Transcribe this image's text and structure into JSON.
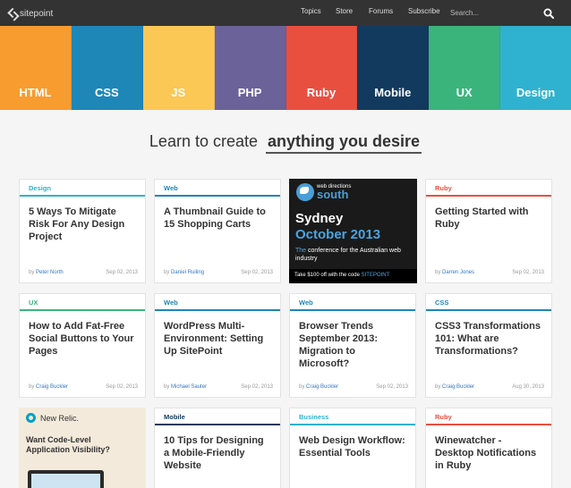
{
  "header": {
    "logo_text": "sitepoint",
    "nav": [
      "Topics",
      "Store",
      "Forums",
      "Subscribe"
    ],
    "search_placeholder": "Search..."
  },
  "categories": [
    {
      "label": "HTML",
      "color": "#f89c2f"
    },
    {
      "label": "CSS",
      "color": "#1f86b8"
    },
    {
      "label": "JS",
      "color": "#fbc755"
    },
    {
      "label": "PHP",
      "color": "#6b6299"
    },
    {
      "label": "Ruby",
      "color": "#e94f3f"
    },
    {
      "label": "Mobile",
      "color": "#123a5f"
    },
    {
      "label": "UX",
      "color": "#3bb47c"
    },
    {
      "label": "Design",
      "color": "#2fb2cf"
    }
  ],
  "headline": {
    "plain": "Learn to create",
    "strong": "anything you desire"
  },
  "colors": {
    "design": "#2fb2cf",
    "web": "#1f86b8",
    "ruby": "#e94f3f",
    "ux": "#3bb47c",
    "css": "#1f86b8",
    "mobile": "#123a5f",
    "business": "#2fb2cf"
  },
  "cards": [
    {
      "tag": "Design",
      "title": "5 Ways To Mitigate Risk For Any Design Project",
      "by": "by",
      "author": "Peter North",
      "date": "Sep 02, 2013"
    },
    {
      "tag": "Web",
      "title": "A Thumbnail Guide to 15 Shopping Carts",
      "by": "by",
      "author": "Daniel Ruiling",
      "date": "Sep 02, 2013"
    },
    {
      "tag": "Ruby",
      "title": "Getting Started with Ruby",
      "by": "by",
      "author": "Darren Jones",
      "date": "Sep 02, 2013"
    },
    {
      "tag": "UX",
      "title": "How to Add Fat-Free Social Buttons to Your Pages",
      "by": "by",
      "author": "Craig Buckler",
      "date": "Sep 02, 2013"
    },
    {
      "tag": "Web",
      "title": "WordPress Multi-Environment: Setting Up SitePoint",
      "by": "by",
      "author": "Michael Sauter",
      "date": "Sep 02, 2013"
    },
    {
      "tag": "Web",
      "title": "Browser Trends September 2013: Migration to Microsoft?",
      "by": "by",
      "author": "Craig Buckler",
      "date": "Sep 02, 2013"
    },
    {
      "tag": "CSS",
      "title": "CSS3 Transformations 101: What are Transformations?",
      "by": "by",
      "author": "Craig Buckler",
      "date": "Aug 30, 2013"
    },
    {
      "tag": "Mobile",
      "title": "10 Tips for Designing a Mobile-Friendly Website"
    },
    {
      "tag": "Business",
      "title": "Web Design Workflow: Essential Tools"
    },
    {
      "tag": "Ruby",
      "title": "Winewatcher - Desktop Notifications in Ruby"
    }
  ],
  "ad_wds": {
    "brand_top": "web directions",
    "brand_bottom": "south",
    "city": "Sydney",
    "date": "October 2013",
    "desc_hl": "The",
    "desc_rest": " conference for the Australian web industry",
    "offer": "Take $100 off with the code ",
    "code": "SITEPOINT"
  },
  "ad_nr": {
    "logo": "New Relic.",
    "text_line1": "Want Code-Level",
    "text_line2": "Application Visibility?"
  }
}
